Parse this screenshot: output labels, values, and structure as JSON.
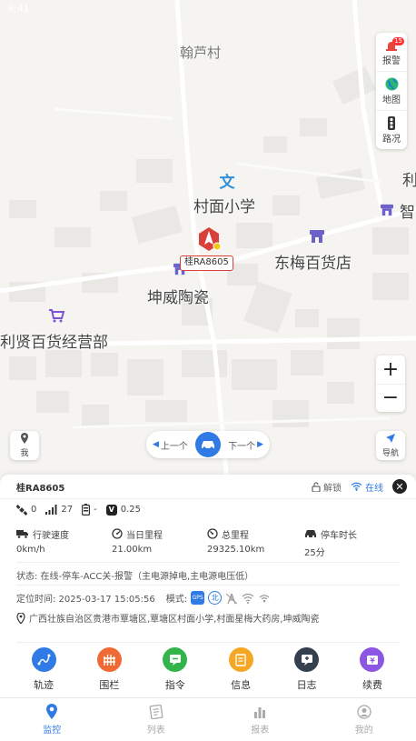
{
  "status_bar": {
    "time": "9:41"
  },
  "map": {
    "pois": [
      {
        "name": "翰芦村",
        "kind": "village"
      },
      {
        "name": "村面小学",
        "kind": "school"
      },
      {
        "name": "东梅百货店",
        "kind": "shop"
      },
      {
        "name": "坤威陶瓷",
        "kind": "shop"
      },
      {
        "name": "利贤百货经营部",
        "kind": "shopping"
      },
      {
        "name": "智",
        "kind": "shop"
      },
      {
        "name": "利",
        "kind": "label"
      }
    ],
    "vehicle_plate": "桂RA8605",
    "side_panel": {
      "alarm_label": "报警",
      "alarm_badge": "15",
      "map_label": "地图",
      "traffic_label": "路况"
    },
    "zoom_in": "+",
    "zoom_out": "−",
    "me_label": "我",
    "nav_label": "导航",
    "prev_label": "上一个",
    "next_label": "下一个"
  },
  "info": {
    "plate": "桂RA8605",
    "unlock_label": "解锁",
    "online_label": "在线",
    "signals": {
      "satellites": "0",
      "gsm": "27",
      "battery": "-",
      "voltage": "0.25"
    },
    "stats": [
      {
        "label": "行驶速度",
        "value": "0km/h"
      },
      {
        "label": "当日里程",
        "value": "21.00km"
      },
      {
        "label": "总里程",
        "value": "29325.10km"
      },
      {
        "label": "停车时长",
        "value": "25分"
      }
    ],
    "status_line": "状态: 在线-停车-ACC关-报警（主电源掉电,主电源电压低）",
    "locate_time": "定位时间: 2025-03-17 15:05:56",
    "mode_label": "模式:",
    "mode_badges": [
      "GPS",
      "北"
    ],
    "address": "广西壮族自治区贵港市覃塘区,覃塘区村面小学,村面星梅大药房,坤威陶瓷",
    "actions": [
      {
        "label": "轨迹",
        "color": "#2f7ae5"
      },
      {
        "label": "围栏",
        "color": "#f06a35"
      },
      {
        "label": "指令",
        "color": "#33b44a"
      },
      {
        "label": "信息",
        "color": "#f5a623"
      },
      {
        "label": "日志",
        "color": "#35404f"
      },
      {
        "label": "续费",
        "color": "#8a56e2"
      }
    ]
  },
  "tabs": [
    {
      "label": "监控",
      "active": true
    },
    {
      "label": "列表",
      "active": false
    },
    {
      "label": "报表",
      "active": false
    },
    {
      "label": "我的",
      "active": false
    }
  ],
  "colors": {
    "accent": "#2f7ae5",
    "alert": "#d9403a"
  }
}
